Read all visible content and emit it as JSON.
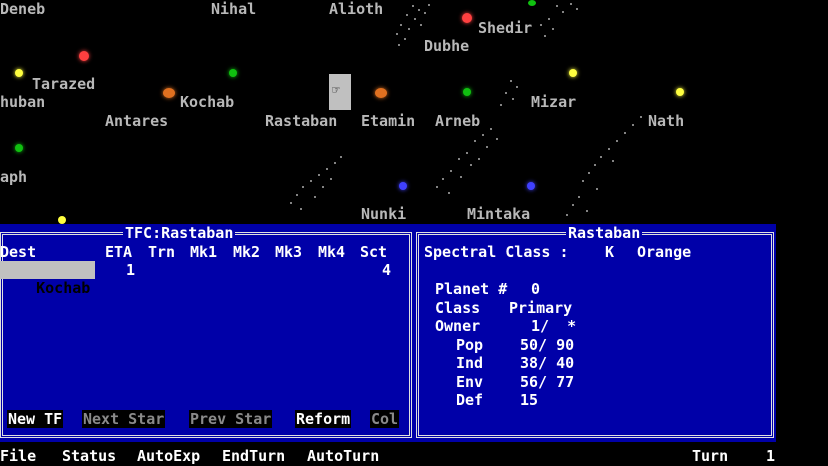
{
  "starmap": {
    "labels": [
      "Deneb",
      "Nihal",
      "Alioth",
      "Shedir",
      "Dubhe",
      "Tarazed",
      "huban",
      "Kochab",
      "Antares",
      "Rastaban",
      "Etamin",
      "Arneb",
      "Mizar",
      "Nath",
      "aph",
      "Nunki",
      "Mintaka"
    ],
    "colors": {
      "red": "#ff4040",
      "orange": "#e07020",
      "yellow": "#ffff40",
      "green": "#10c010",
      "blue": "#4040ff"
    }
  },
  "tfc_panel": {
    "title": "TFC:Rastaban",
    "headers": [
      "Dest",
      "ETA",
      "Trn",
      "Mk1",
      "Mk2",
      "Mk3",
      "Mk4",
      "Sct"
    ],
    "rows": [
      {
        "dest": "Kochab",
        "eta": "1",
        "sct": "4"
      }
    ],
    "buttons": [
      "New TF",
      "Next Star",
      "Prev Star",
      "Reform",
      "Col"
    ]
  },
  "star_panel": {
    "title": "Rastaban",
    "spectral_label": "Spectral Class :",
    "spectral_class": "K",
    "spectral_color": "Orange",
    "planet_label": "Planet #",
    "planet_num": "0",
    "class_label": "Class",
    "class_value": "Primary",
    "owner_label": "Owner",
    "owner_value": "1/  *",
    "pop_label": "Pop",
    "pop_value": "50/ 90",
    "ind_label": "Ind",
    "ind_value": "38/ 40",
    "env_label": "Env",
    "env_value": "56/ 77",
    "def_label": "Def",
    "def_value": "15"
  },
  "menubar": {
    "items": [
      "File",
      "Status",
      "AutoExp",
      "EndTurn",
      "AutoTurn"
    ],
    "turn_label": "Turn",
    "turn_value": "1"
  }
}
